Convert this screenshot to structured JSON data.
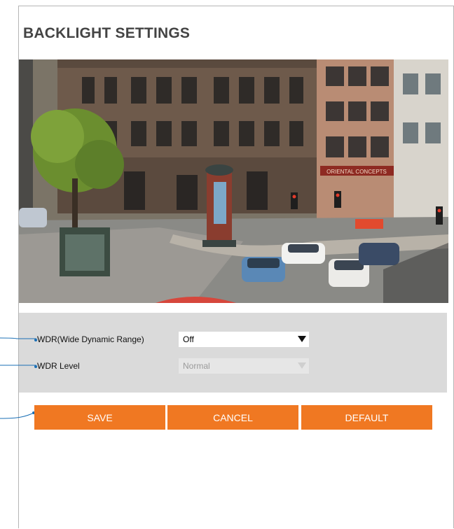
{
  "page": {
    "title": "BACKLIGHT SETTINGS"
  },
  "video": {
    "signs": [
      "ORIENTAL CONCEPTS"
    ]
  },
  "settings": {
    "wdr": {
      "label": "WDR(Wide Dynamic Range)",
      "value": "Off"
    },
    "wdr_level": {
      "label": "WDR Level",
      "value": "Normal",
      "disabled": true
    }
  },
  "buttons": {
    "save": "SAVE",
    "cancel": "CANCEL",
    "default": "DEFAULT"
  },
  "colors": {
    "accent": "#f07822",
    "leader": "#1a6fb5",
    "settings_bg": "#dadada"
  },
  "icons": [
    "caret-down-icon"
  ]
}
